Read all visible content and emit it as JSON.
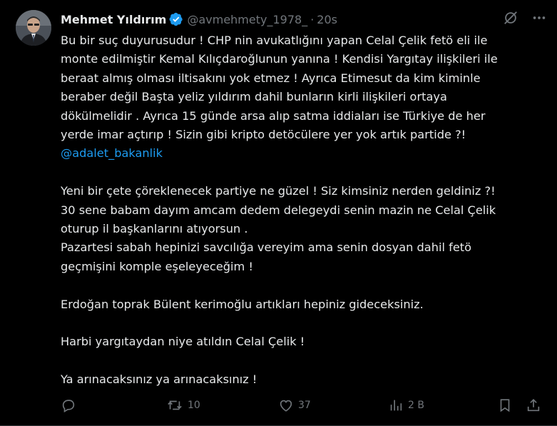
{
  "author": {
    "display_name": "Mehmet Yıldırım",
    "handle": "@avmehmety_1978_",
    "separator": "·",
    "time": "20s",
    "verified_color": "#1d9bf0"
  },
  "tweet": {
    "paragraphs": [
      {
        "lines": [
          "Bu bir suç duyurusudur ! CHP nin avukatlığını yapan Celal Çelik fetö eli ile",
          "monte edilmiştir Kemal Kılıçdaroğlunun yanına ! Kendisi Yargıtay ilişkileri ile",
          "beraat almış olması iltisakını yok etmez ! Ayrıca Etimesut da kim kiminle",
          "beraber değil Başta yeliz yıldırım dahil bunların kirli ilişkileri ortaya",
          "dökülmelidir . Ayrıca 15  günde arsa alıp satma iddiaları ise Türkiye de her",
          "yerde imar açtırıp ! Sizin gibi kripto detöcülere yer yok artık partide ?!"
        ],
        "mention": "@adalet_bakanlik"
      },
      {
        "lines": [
          "Yeni bir çete çöreklenecek partiye ne güzel ! Siz kimsiniz nerden geldiniz ?!",
          "30 sene babam dayım amcam dedem delegeydi senin mazin ne Celal Çelik",
          "oturup il başkanlarını atıyorsun .",
          "Pazartesi sabah hepinizi savcılığa vereyim ama senin dosyan dahil fetö",
          "geçmişini komple eşeleyeceğim !"
        ]
      },
      {
        "lines": [
          "Erdoğan toprak Bülent kerimoğlu artıkları hepiniz gideceksiniz."
        ]
      },
      {
        "lines": [
          "Harbi yargıtaydan niye atıldın Celal Çelik !"
        ]
      },
      {
        "lines": [
          "Ya arınacaksınız ya arınacaksınız !"
        ]
      }
    ]
  },
  "actions": {
    "reply_count": "",
    "retweet_count": "10",
    "like_count": "37",
    "views_count": "2 B"
  },
  "icons": {
    "grok": "grok-icon",
    "more": "more-icon",
    "reply": "reply-icon",
    "retweet": "retweet-icon",
    "like": "heart-icon",
    "views": "views-icon",
    "bookmark": "bookmark-icon",
    "share": "share-icon"
  },
  "colors": {
    "background": "#000000",
    "text": "#e7e9ea",
    "secondary": "#71767b",
    "accent": "#1d9bf0"
  }
}
